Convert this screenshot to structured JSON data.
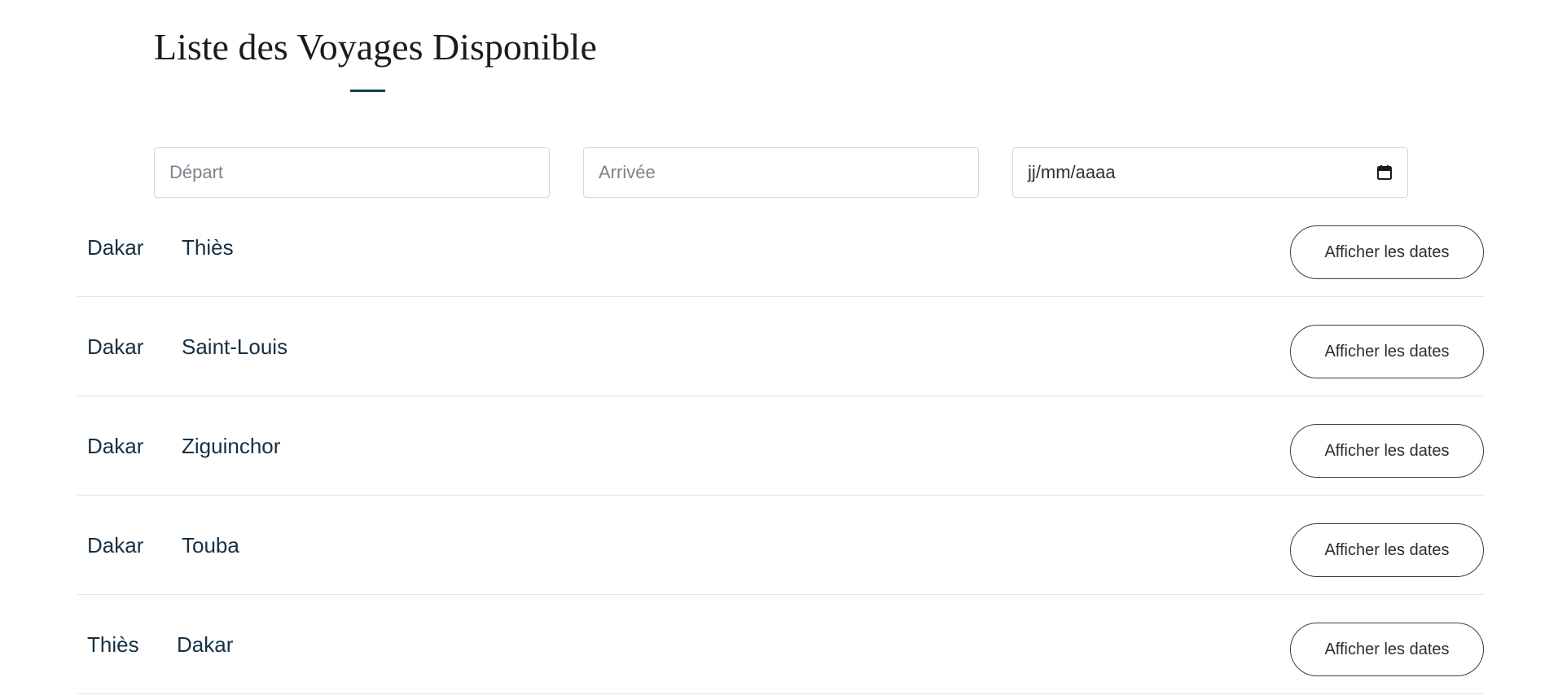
{
  "header": {
    "title": "Liste des Voyages Disponible"
  },
  "filters": {
    "depart_placeholder": "Départ",
    "arrivee_placeholder": "Arrivée",
    "date_placeholder": "jj/mm/aaaa",
    "date_icon": "calendar-icon"
  },
  "trips": [
    {
      "from": "Dakar",
      "to": "Thiès",
      "button_label": "Afficher les dates"
    },
    {
      "from": "Dakar",
      "to": "Saint-Louis",
      "button_label": "Afficher les dates"
    },
    {
      "from": "Dakar",
      "to": "Ziguinchor",
      "button_label": "Afficher les dates"
    },
    {
      "from": "Dakar",
      "to": "Touba",
      "button_label": "Afficher les dates"
    },
    {
      "from": "Thiès",
      "to": "Dakar",
      "button_label": "Afficher les dates"
    }
  ],
  "colors": {
    "text": "#163043",
    "title": "#1b1b1b",
    "accent": "#1a3a4e",
    "border": "#d4d7dc",
    "divider": "#e3e5e8"
  }
}
